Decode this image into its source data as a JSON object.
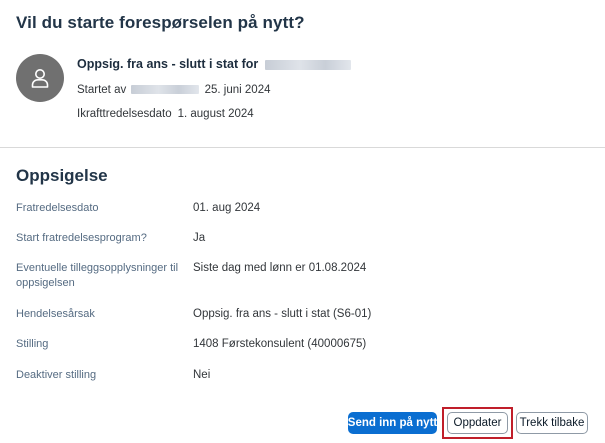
{
  "dialog": {
    "title": "Vil du starte forespørselen på nytt?"
  },
  "request": {
    "title_prefix": "Oppsig. fra ans - slutt i stat for",
    "started_by_label": "Startet av",
    "started_date": "25. juni 2024",
    "effective_label": "Ikrafttredelsesdato",
    "effective_date": "1. august 2024",
    "avatar_icon": "person-icon"
  },
  "section": {
    "title": "Oppsigelse",
    "fields": [
      {
        "label": "Fratredelsesdato",
        "value": "01. aug 2024"
      },
      {
        "label": "Start fratredelsesprogram?",
        "value": "Ja"
      },
      {
        "label": "Eventuelle tilleggsopplysninger til oppsigelsen",
        "value": "Siste dag med lønn er 01.08.2024"
      },
      {
        "label": "Hendelsesårsak",
        "value": "Oppsig. fra ans - slutt i stat (S6-01)"
      },
      {
        "label": "Stilling",
        "value": "1408 Førstekonsulent (40000675)"
      },
      {
        "label": "Deaktiver stilling",
        "value": "Nei"
      }
    ]
  },
  "footer": {
    "submit_label": "Send inn på nytt",
    "update_label": "Oppdater",
    "withdraw_label": "Trekk tilbake"
  },
  "colors": {
    "primary": "#0a6ed1",
    "highlight": "#c01e2a",
    "avatar": "#707070"
  }
}
